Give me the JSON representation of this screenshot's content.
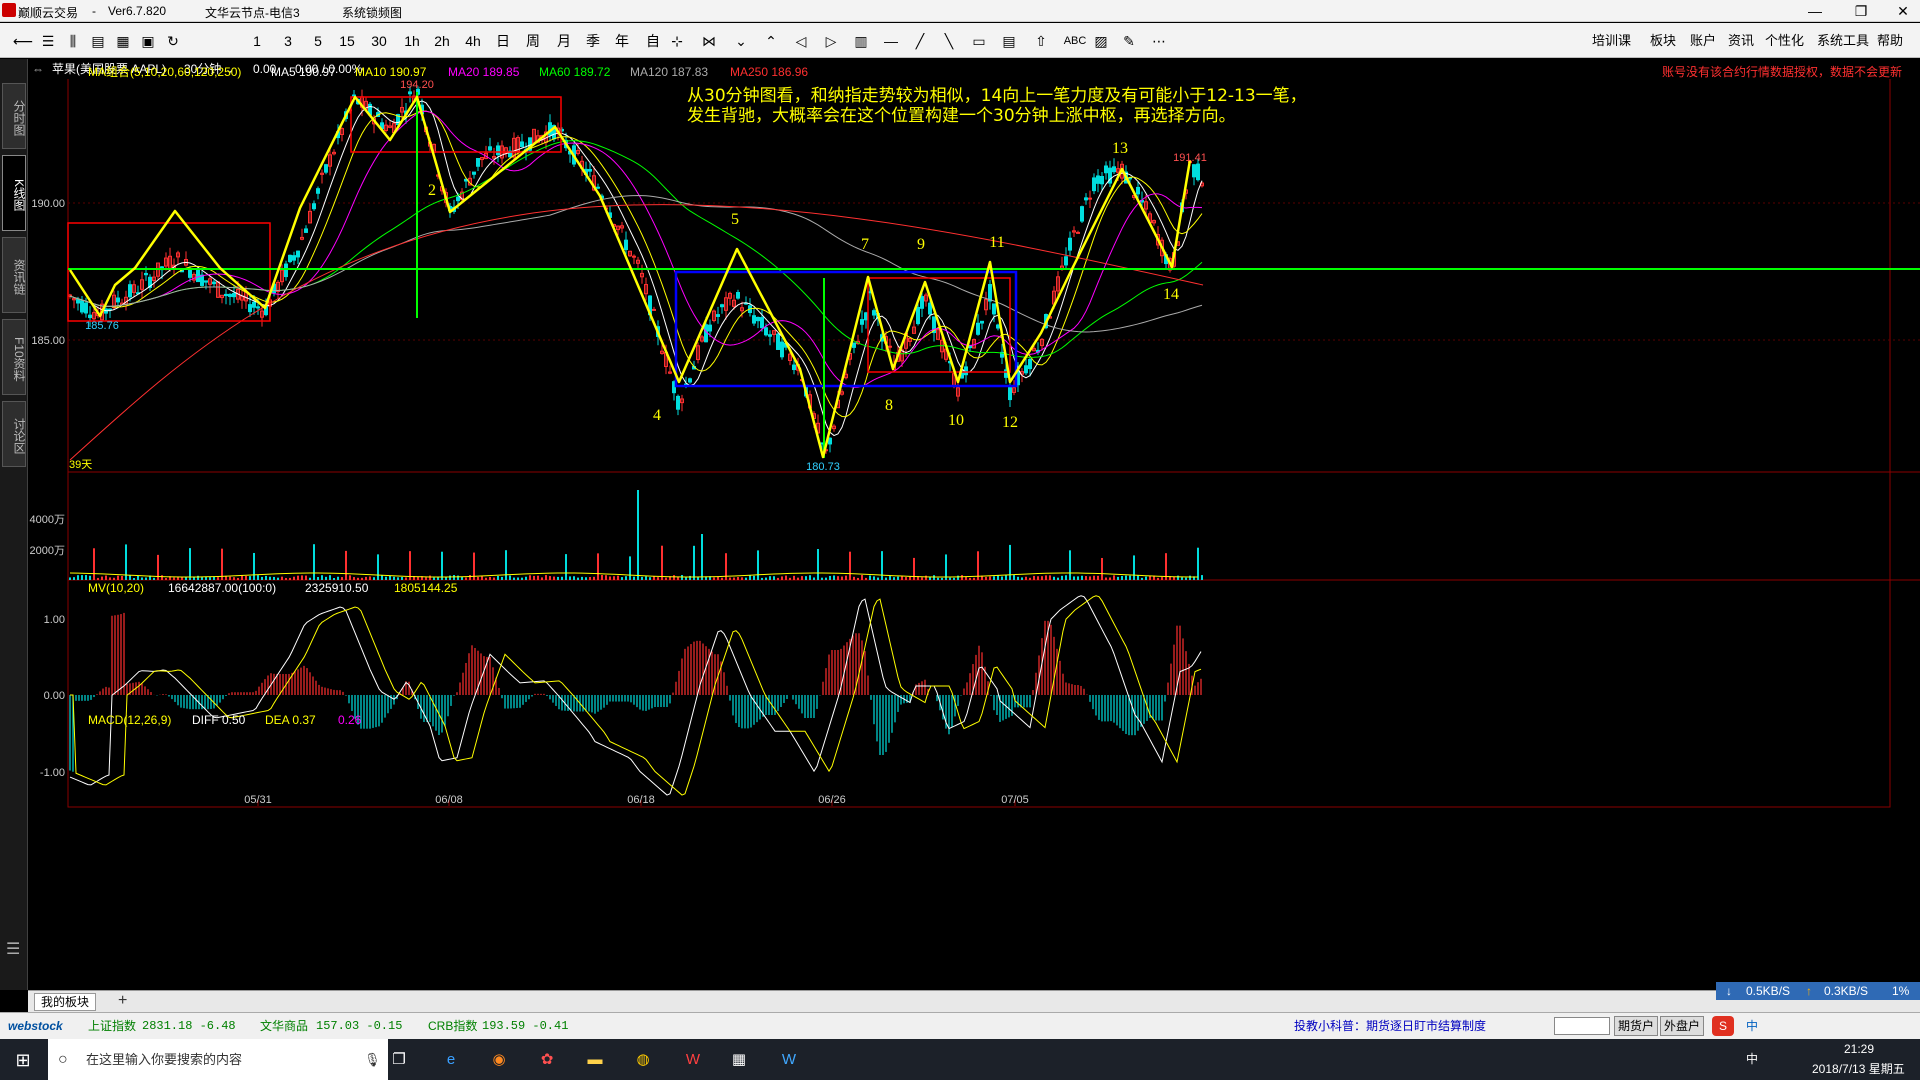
{
  "window": {
    "app_name": "巅顺云交易",
    "separator": "-",
    "version": "Ver6.7.820",
    "server": "文华云节点-电信3",
    "extra": "系统锁频图",
    "btn_min": "—",
    "btn_restore": "❐",
    "btn_close": "✕"
  },
  "toolbar": {
    "periods": [
      "1",
      "3",
      "5",
      "15",
      "30",
      "1h",
      "2h",
      "4h",
      "日",
      "周",
      "月",
      "季",
      "年",
      "自"
    ],
    "icons": [
      "back-arrow-icon",
      "list-icon",
      "kline-icon",
      "doc-icon",
      "grid-icon",
      "save-icon",
      "refresh-icon"
    ],
    "tool_icons": [
      "cross-icon",
      "sync-icon",
      "expand-icon",
      "collapse-icon",
      "left-icon",
      "right-icon",
      "layout-icon",
      "hline-icon",
      "line-icon",
      "ray-icon",
      "rect-icon",
      "grid2-icon",
      "up-arrow-icon",
      "text-icon",
      "fill-icon",
      "pen-icon",
      "more-icon"
    ],
    "abc_label": "ABC",
    "right_menu": [
      "培训课",
      "板块",
      "账户",
      "资讯",
      "个性化",
      "系统工具",
      "帮助"
    ]
  },
  "stock": {
    "name": "苹果(美国股票 AAPL)",
    "period": "30分钟",
    "price": "0.00",
    "change": "0.00 / 0.00%"
  },
  "left_tabs": [
    "分时图",
    "K线图",
    "资讯链",
    "F10资料",
    "讨论区"
  ],
  "left_tab_active": 1,
  "main_panel": {
    "ma_label": "MA组合(5,10,20,60,120,250)",
    "ma5": "MA5 190.97",
    "ma10": "MA10 190.97",
    "ma20": "MA20 189.85",
    "ma60": "MA60 189.72",
    "ma120": "MA120 187.83",
    "ma250": "MA250 186.96",
    "warning": "账号没有该合约行情数据授权，数据不会更新",
    "annotation_line1": "从30分钟图看，和纳指走势较为相似，14向上一笔力度及有可能小于12-13一笔，",
    "annotation_line2": "发生背驰，大概率会在这个位置构建一个30分钟上涨中枢，再选择方向。",
    "high_label": "194.20",
    "low_label": "185.76",
    "low2_label": "180.73",
    "recent_high_label": "191.41",
    "days_label": "39天",
    "y_tick_190": "190.00",
    "y_tick_185": "185.00",
    "stroke_labels": [
      "2",
      "4",
      "5",
      "7",
      "8",
      "9",
      "10",
      "11",
      "12",
      "13",
      "14"
    ]
  },
  "volume_panel": {
    "label": "MV(10,20)",
    "v1": "16642887.00(100:0)",
    "v2": "2325910.50",
    "v3": "1805144.25",
    "y_tick_4000": "4000万",
    "y_tick_2000": "2000万"
  },
  "macd_panel": {
    "label": "MACD(12,26,9)",
    "diff": "DIFF 0.50",
    "dea": "DEA 0.37",
    "macd": "0.26",
    "y_tick_1": "1.00",
    "y_tick_0": "0.00",
    "y_tick_m1": "-1.00"
  },
  "dates": [
    "05/31",
    "06/08",
    "06/18",
    "06/26",
    "07/05"
  ],
  "colors": {
    "bg": "#000000",
    "grid_red": "#8a0000",
    "ma5": "#ffffff",
    "ma10": "#ffff00",
    "ma20": "#ff00ff",
    "ma60": "#00ff00",
    "ma120": "#aaaaaa",
    "ma250": "#ff3030",
    "stroke_yellow": "#ffff00",
    "hub_red": "#ff0000",
    "hub_blue": "#0000ff",
    "level_green": "#00ff00",
    "bar_up": "#ff3030",
    "bar_down": "#00dede"
  },
  "bottom_tab": "我的板块",
  "bottom_tab_plus": "+",
  "netspeed": {
    "down": "0.5KB/S",
    "up": "0.3KB/S",
    "pct": "1%"
  },
  "ticker": {
    "brand": "webstock",
    "t1_name": "上证指数",
    "t1_val": "2831.18 -6.48",
    "t2_name": "文华商品",
    "t2_val": "157.03 -0.15",
    "t3_name": "CRB指数",
    "t3_val": "193.59 -0.41",
    "notice": "投教小科普：期货逐日盯市结算制度",
    "btn_futures": "期货户",
    "btn_fx": "外盘户"
  },
  "taskbar": {
    "search_placeholder": "在这里输入你要搜索的内容",
    "time": "21:29",
    "date": "2018/7/13 星期五",
    "ime": "中",
    "apps": [
      "task-view-icon",
      "edge-icon",
      "browser-icon",
      "app-red-icon",
      "explorer-icon",
      "app-yellow-icon",
      "wenhua-icon",
      "calculator-icon",
      "app-blue-icon"
    ]
  }
}
